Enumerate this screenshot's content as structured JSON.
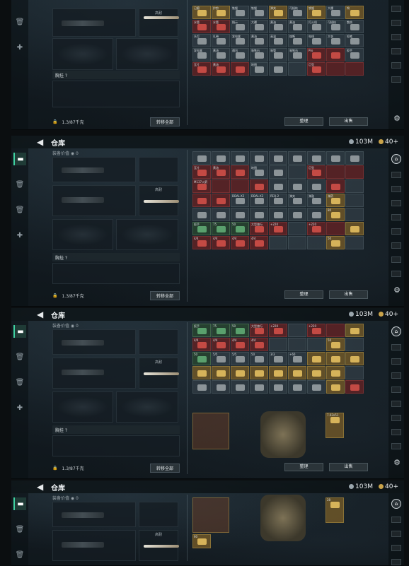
{
  "header": {
    "title": "仓库",
    "silver": "103M",
    "gold": "40+"
  },
  "equip": {
    "worth": "装备价值 ◉ 0",
    "pouch": "胸挂 ?",
    "pouch_tag": "高耐",
    "weight": "1.3/87千克",
    "move_all": "转移全部"
  },
  "actions": {
    "sort": "整理",
    "sell": "出售"
  },
  "rows": {
    "r1": [
      "已磨",
      "护剪",
      "铁锯",
      "铁锯",
      "弹夹",
      "可插枝",
      "铁锯",
      "大绷",
      "钩"
    ],
    "r2": [
      "水管",
      "水管",
      "指示",
      "大绷",
      "黄油",
      "黄油",
      "打火机",
      "可插枝",
      "散热"
    ],
    "r3": [
      "头灯",
      "扎带",
      "发电盒",
      "黄油",
      "高温",
      "熔断",
      "电线",
      "大衣",
      "铅笔"
    ],
    "r4": [
      "发电盒",
      "黄油",
      "通讯",
      "吸铁石",
      "吸管",
      "吸铁石",
      "Pro",
      "",
      "扳手"
    ],
    "r5": [
      "瓦片",
      "黄油",
      "",
      "地图",
      "",
      "",
      "巨型",
      "",
      ""
    ],
    "r6": [
      "M137火箭",
      "",
      "",
      "DBAL-X2",
      "DBAL-X2",
      "PEQ-2",
      "弹夹",
      "弹鼓",
      "弹药"
    ],
    "r7": [
      "扳手",
      "头盔",
      "老",
      "大型旅行",
      "",
      "",
      "",
      "",
      "80"
    ],
    "r8": [
      "75",
      "50",
      "+220",
      "+220",
      "+220",
      "",
      "",
      "",
      ""
    ],
    "r9": [
      "4/4",
      "4/4",
      "4/4",
      "4/4",
      "50",
      "",
      "",
      "",
      ""
    ],
    "r10": [
      "50",
      "5/5",
      "5/5",
      "50",
      "3/3",
      "+60",
      "",
      "",
      ""
    ],
    "r11": [
      "7.62x51",
      "",
      "",
      "",
      "",
      "",
      "",
      "",
      ""
    ],
    "r12": [
      "60",
      "28",
      "",
      "",
      "",
      "",
      "",
      "",
      ""
    ]
  }
}
